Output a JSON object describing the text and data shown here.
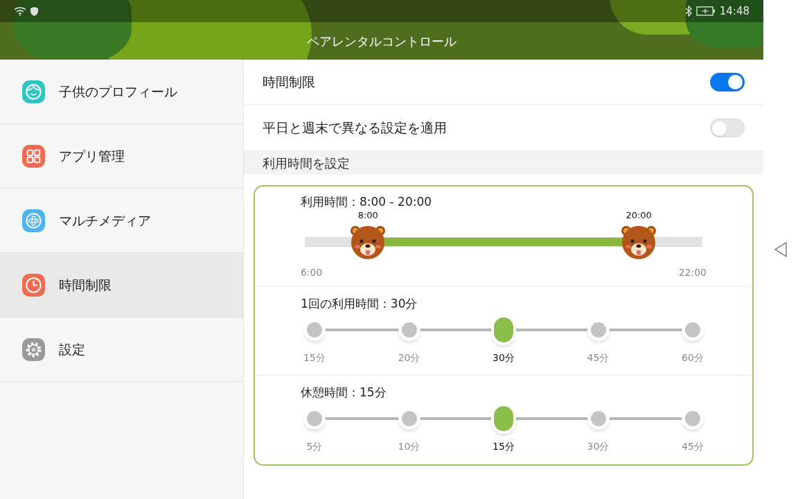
{
  "status_bar": {
    "time": "14:48"
  },
  "title": "ペアレンタルコントロール",
  "sidebar": {
    "items": [
      {
        "label": "子供のプロフィール",
        "kind": "face",
        "color": "#2ec4c0",
        "selected": false
      },
      {
        "label": "アプリ管理",
        "kind": "grid",
        "color": "#f26b4e",
        "selected": false
      },
      {
        "label": "マルチメディア",
        "kind": "film",
        "color": "#4fb3f0",
        "selected": false
      },
      {
        "label": "時間制限",
        "kind": "clock",
        "color": "#f26b4e",
        "selected": true
      },
      {
        "label": "設定",
        "kind": "gear",
        "color": "#9a9a9e",
        "selected": false
      }
    ]
  },
  "settings": [
    {
      "label": "時間制限",
      "on": true
    },
    {
      "label": "平日と週末で異なる設定を適用",
      "on": false
    }
  ],
  "section_header": "利用時間を設定",
  "range": {
    "title": "利用時間：8:00 - 20:00",
    "min_label": "6:00",
    "max_label": "22:00",
    "handles": [
      {
        "label": "8:00",
        "level": 0.159
      },
      {
        "label": "20:00",
        "level": 0.84
      }
    ]
  },
  "steppers": [
    {
      "title": "1回の利用時間：30分",
      "options": [
        {
          "label": "15分",
          "selected": false
        },
        {
          "label": "20分",
          "selected": false
        },
        {
          "label": "30分",
          "selected": true
        },
        {
          "label": "45分",
          "selected": false
        },
        {
          "label": "60分",
          "selected": false
        }
      ]
    },
    {
      "title": "休憩時間：15分",
      "options": [
        {
          "label": "5分",
          "selected": false
        },
        {
          "label": "10分",
          "selected": false
        },
        {
          "label": "15分",
          "selected": true
        },
        {
          "label": "30分",
          "selected": false
        },
        {
          "label": "45分",
          "selected": false
        }
      ]
    }
  ]
}
